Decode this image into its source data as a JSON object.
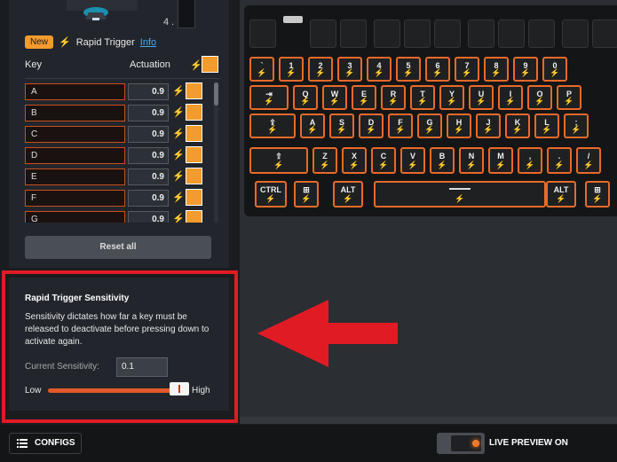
{
  "device": {
    "thumb_number": "4 ."
  },
  "rapid_trigger": {
    "badge": "New",
    "label": "Rapid Trigger",
    "info_link": "Info"
  },
  "table": {
    "col_key": "Key",
    "col_actuation": "Actuation",
    "rows": [
      {
        "key": "A",
        "value": "0.9"
      },
      {
        "key": "B",
        "value": "0.9"
      },
      {
        "key": "C",
        "value": "0.9"
      },
      {
        "key": "D",
        "value": "0.9"
      },
      {
        "key": "E",
        "value": "0.9"
      },
      {
        "key": "F",
        "value": "0.9"
      },
      {
        "key": "G",
        "value": "0.9"
      }
    ]
  },
  "reset_label": "Reset all",
  "sensitivity": {
    "title": "Rapid Trigger Sensitivity",
    "description": "Sensitivity dictates how far a key must be released to deactivate before pressing down to activate again.",
    "current_label": "Current Sensitivity:",
    "current_value": "0.1",
    "low_label": "Low",
    "high_label": "High",
    "slider_level": 1.0
  },
  "keyboard": {
    "rows": [
      [
        "`",
        "1",
        "2",
        "3",
        "4",
        "5",
        "6",
        "7",
        "8",
        "9",
        "0"
      ],
      [
        "⇥",
        "Q",
        "W",
        "E",
        "R",
        "T",
        "Y",
        "U",
        "I",
        "O",
        "P"
      ],
      [
        "⇪",
        "A",
        "S",
        "D",
        "F",
        "G",
        "H",
        "J",
        "K",
        "L",
        ";"
      ],
      [
        "⇧",
        "Z",
        "X",
        "C",
        "V",
        "B",
        "N",
        "M",
        ",",
        ".",
        "/"
      ],
      [
        "CTRL",
        "⊞",
        "ALT",
        "",
        "ALT",
        "⊞"
      ]
    ]
  },
  "bottom": {
    "configs_label": "CONFIGS",
    "live_preview_label": "LIVE PREVIEW ON"
  },
  "colors": {
    "accent": "#f29b2e",
    "key_border": "#e86a2a",
    "highlight_frame": "#e11b24"
  }
}
